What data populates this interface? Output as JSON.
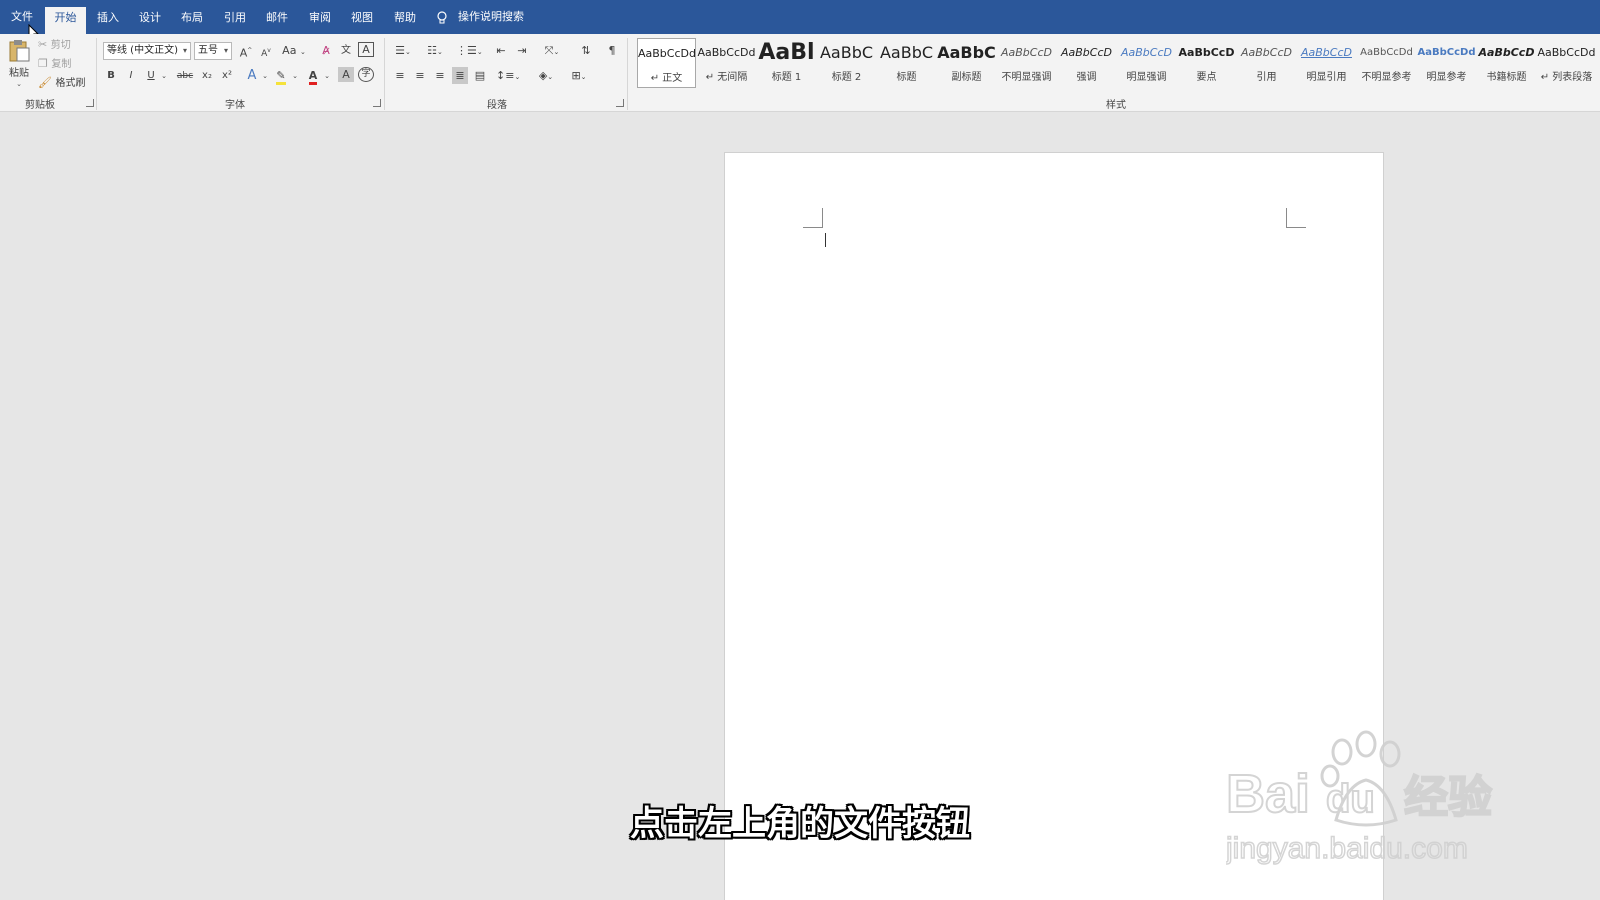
{
  "tabs": {
    "file": "文件",
    "home": "开始",
    "insert": "插入",
    "design": "设计",
    "layout": "布局",
    "references": "引用",
    "mailings": "邮件",
    "review": "审阅",
    "view": "视图",
    "help": "帮助",
    "tell_me": "操作说明搜索"
  },
  "clipboard": {
    "paste": "粘贴",
    "cut": "剪切",
    "copy": "复制",
    "format_painter": "格式刷",
    "group_label": "剪贴板"
  },
  "font": {
    "font_name": "等线 (中文正文)",
    "font_size": "五号",
    "group_label": "字体",
    "grow": "A",
    "shrink": "A",
    "change_case": "Aa",
    "phonetic": "文",
    "char_border": "A",
    "bold": "B",
    "italic": "I",
    "underline": "U",
    "strikethrough": "abc",
    "subscript": "x₂",
    "superscript": "x²",
    "text_effects": "A",
    "font_color": "A",
    "char_shading": "A",
    "enclose": "字"
  },
  "paragraph": {
    "group_label": "段落"
  },
  "styles": {
    "group_label": "样式",
    "items": [
      {
        "sample": "AaBbCcDd",
        "name": "↵ 正文"
      },
      {
        "sample": "AaBbCcDd",
        "name": "↵ 无间隔"
      },
      {
        "sample": "AaBl",
        "name": "标题 1"
      },
      {
        "sample": "AaBbC",
        "name": "标题 2"
      },
      {
        "sample": "AaBbC",
        "name": "标题"
      },
      {
        "sample": "AaBbC",
        "name": "副标题"
      },
      {
        "sample": "AaBbCcD",
        "name": "不明显强调"
      },
      {
        "sample": "AaBbCcD",
        "name": "强调"
      },
      {
        "sample": "AaBbCcD",
        "name": "明显强调"
      },
      {
        "sample": "AaBbCcD",
        "name": "要点"
      },
      {
        "sample": "AaBbCcD",
        "name": "引用"
      },
      {
        "sample": "AaBbCcD",
        "name": "明显引用"
      },
      {
        "sample": "AaBbCcDd",
        "name": "不明显参考"
      },
      {
        "sample": "AaBbCcDd",
        "name": "明显参考"
      },
      {
        "sample": "AaBbCcD",
        "name": "书籍标题"
      },
      {
        "sample": "AaBbCcDd",
        "name": "↵ 列表段落"
      }
    ]
  },
  "subtitle": "点击左上角的文件按钮",
  "watermark": {
    "brand_text": "Baidu经验",
    "url": "jingyan.baidu.com"
  },
  "colors": {
    "tabbar": "#2b579a",
    "ribbon": "#f3f3f3",
    "workspace": "#e6e6e6"
  }
}
